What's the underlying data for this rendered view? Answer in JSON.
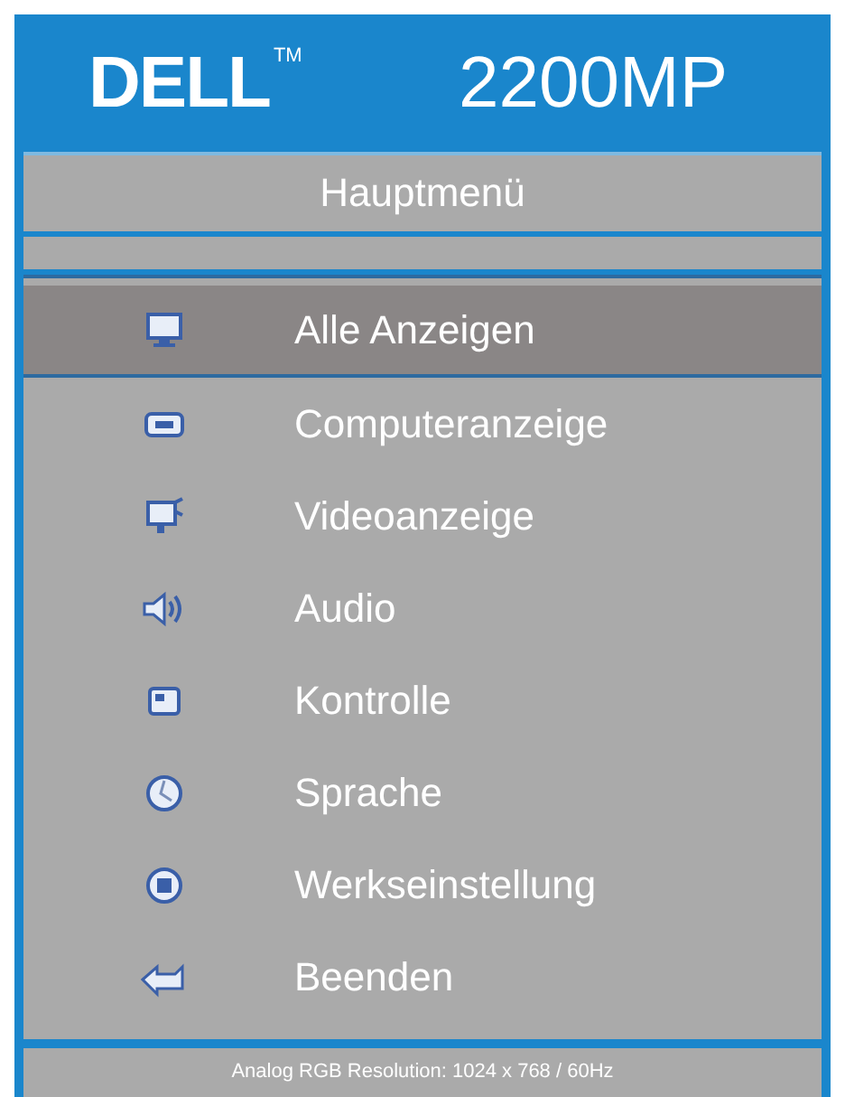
{
  "header": {
    "logo": "DELL",
    "trademark": "TM",
    "model": "2200MP"
  },
  "menu_title": "Hauptmenü",
  "items": [
    {
      "label": "Alle Anzeigen",
      "selected": true
    },
    {
      "label": "Computeranzeige",
      "selected": false
    },
    {
      "label": "Videoanzeige",
      "selected": false
    },
    {
      "label": "Audio",
      "selected": false
    },
    {
      "label": "Kontrolle",
      "selected": false
    },
    {
      "label": "Sprache",
      "selected": false
    },
    {
      "label": "Werkseinstellung",
      "selected": false
    },
    {
      "label": "Beenden",
      "selected": false
    }
  ],
  "status_bar": "Analog RGB Resolution: 1024 x 768 / 60Hz"
}
